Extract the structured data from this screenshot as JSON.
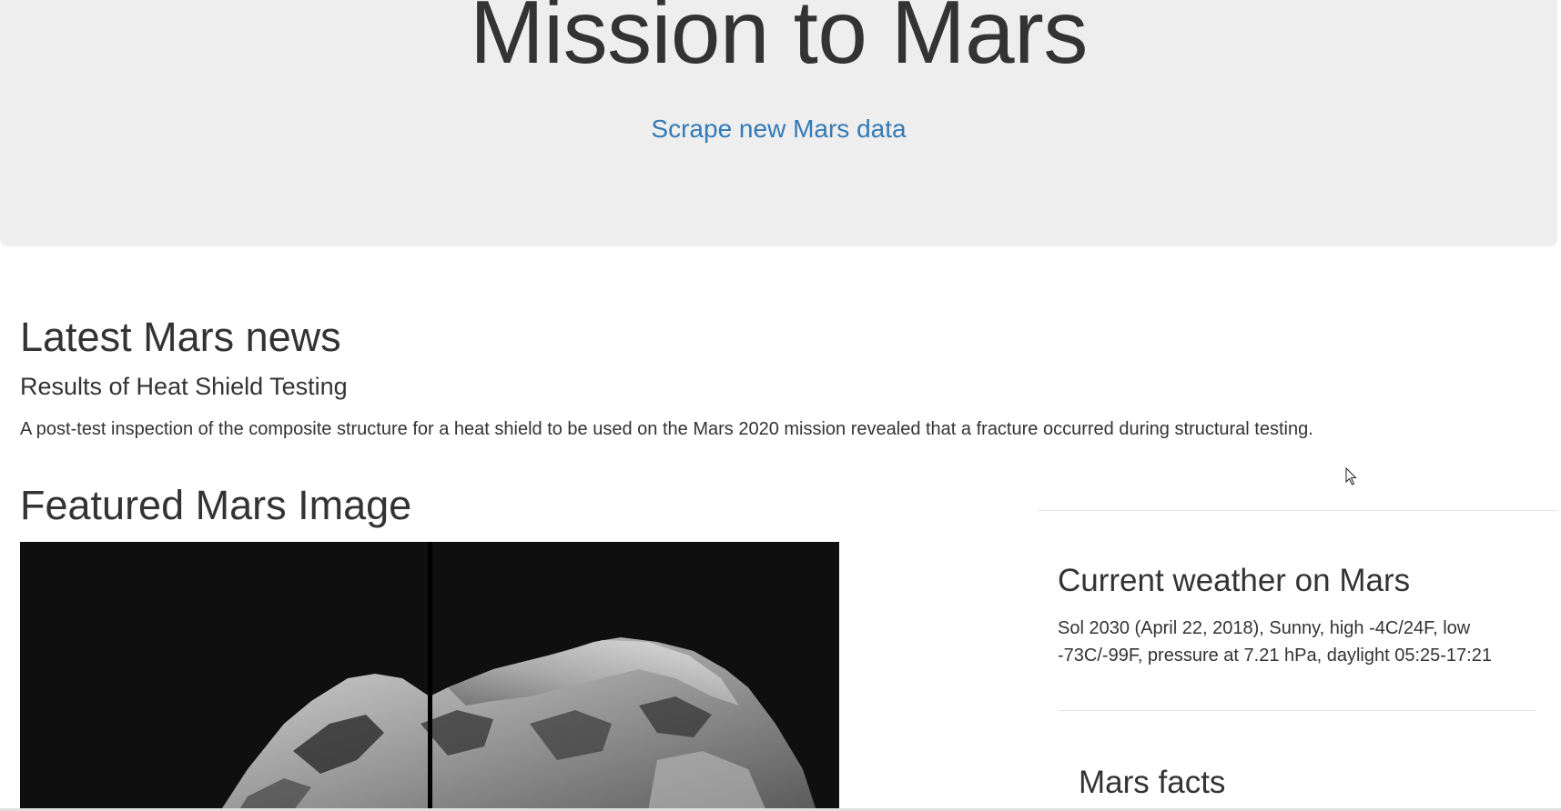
{
  "jumbotron": {
    "title": "Mission to Mars",
    "scrape_button_label": "Scrape new Mars data"
  },
  "news": {
    "heading": "Latest Mars news",
    "title": "Results of Heat Shield Testing",
    "teaser": "A post-test inspection of the composite structure for a heat shield to be used on the Mars 2020 mission revealed that a fracture occurred during structural testing."
  },
  "featured_image": {
    "heading": "Featured Mars Image"
  },
  "weather": {
    "heading": "Current weather on Mars",
    "report": "Sol 2030 (April 22, 2018), Sunny, high -4C/24F, low -73C/-99F, pressure at 7.21 hPa, daylight 05:25-17:21"
  },
  "facts": {
    "heading": "Mars facts"
  },
  "colors": {
    "jumbotron_bg": "#eeeeee",
    "link": "#337ab7",
    "text": "#333333"
  }
}
